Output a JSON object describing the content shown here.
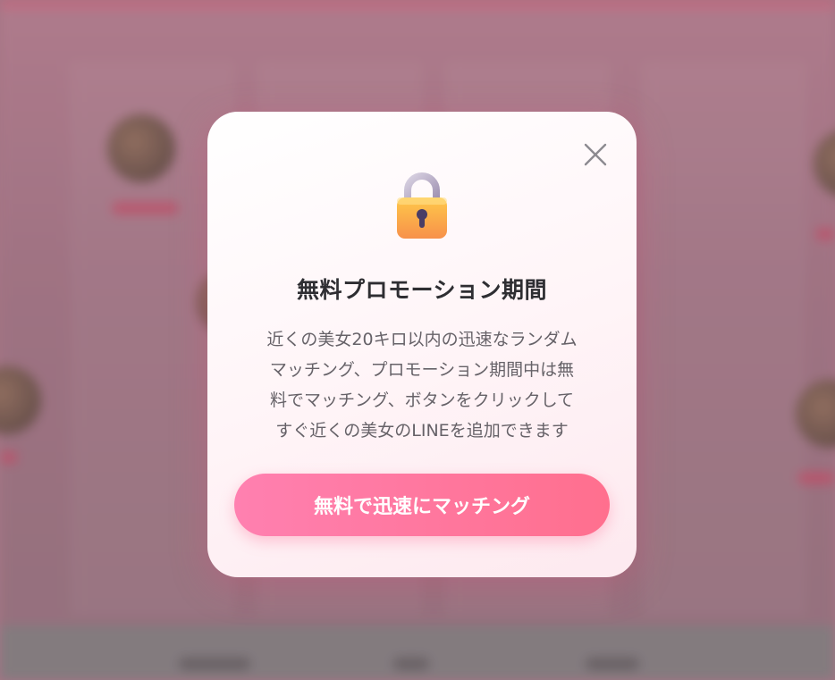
{
  "colors": {
    "accent": "#ff6f8e",
    "accent_start": "#ff80b0",
    "title": "#2e2e32",
    "body_text": "#666268",
    "modal_bg": "#ffffff"
  },
  "modal": {
    "close_icon": "close-icon",
    "lock_icon": "lock-icon",
    "title": "無料プロモーション期間",
    "description_lines": [
      "近くの美女20キロ以内の迅速なランダム",
      "マッチング、プロモーション期間中は無",
      "料でマッチング、ボタンをクリックして",
      "すぐ近くの美女のLINEを追加できます"
    ],
    "cta_label": "無料で迅速にマッチング"
  }
}
